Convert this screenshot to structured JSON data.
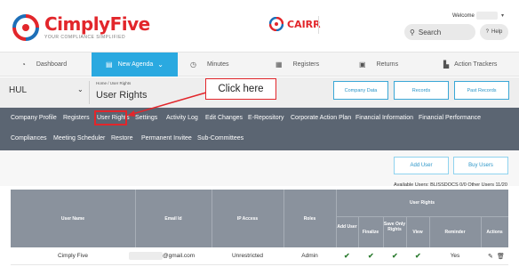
{
  "header": {
    "brand": "CimplyFive",
    "brand_first": "Cimply",
    "brand_second": "Five",
    "tagline": "YOUR COMPLIANCE SIMPLIFIED",
    "product": "CAIRR",
    "welcome": "Welcome",
    "search_label": "Search",
    "help_label": "Help"
  },
  "nav": {
    "items": [
      {
        "label": "Dashboard",
        "icon": "dashboard-icon"
      },
      {
        "label": "New Agenda",
        "icon": "agenda-icon",
        "active": true
      },
      {
        "label": "Minutes",
        "icon": "clock-icon"
      },
      {
        "label": "Registers",
        "icon": "register-icon"
      },
      {
        "label": "Returns",
        "icon": "document-icon"
      },
      {
        "label": "Action Trackers",
        "icon": "tracker-icon"
      }
    ]
  },
  "company": {
    "selected": "HUL",
    "breadcrumb": "Home  /  User Rights",
    "title": "User Rights",
    "buttons": [
      "Company Data",
      "Records",
      "Past Records"
    ]
  },
  "callout": "Click here",
  "subnav": {
    "row1": [
      "Company Profile",
      "Registers",
      "User Rights",
      "Settings",
      "Activity Log",
      "Edit Changes",
      "E-Repository",
      "Corporate Action Plan",
      "Financial Information",
      "Financial Performance"
    ],
    "row2": [
      "Compliances",
      "Meeting Scheduler",
      "Restore",
      "Permanent Invitee",
      "Sub-Committees"
    ]
  },
  "actions": {
    "add_user": "Add User",
    "buy_users": "Buy Users",
    "available": "Available Users: BLISSDOCS 0/0 Other Users 11/20"
  },
  "table": {
    "headers": {
      "user_name": "User Name",
      "email": "Email Id",
      "ip_access": "IP Access",
      "roles": "Roles",
      "user_rights": "User Rights",
      "add_user": "Add User",
      "finalize": "Finalize",
      "save_only_rights": "Save Only Rights",
      "view": "View",
      "reminder": "Reminder",
      "actions": "Actions"
    },
    "rows": [
      {
        "user_name": "Cimply Five",
        "email": "@gmail.com",
        "ip_access": "Unrestricted",
        "roles": "Admin",
        "add_user": true,
        "finalize": true,
        "save_only_rights": true,
        "view": true,
        "reminder": "Yes"
      }
    ]
  },
  "colors": {
    "brand_red": "#e2262b",
    "nav_active": "#2aa9e0",
    "subnav_bg": "#5b6572",
    "table_header": "#8a929d",
    "check_green": "#2e7d32"
  }
}
